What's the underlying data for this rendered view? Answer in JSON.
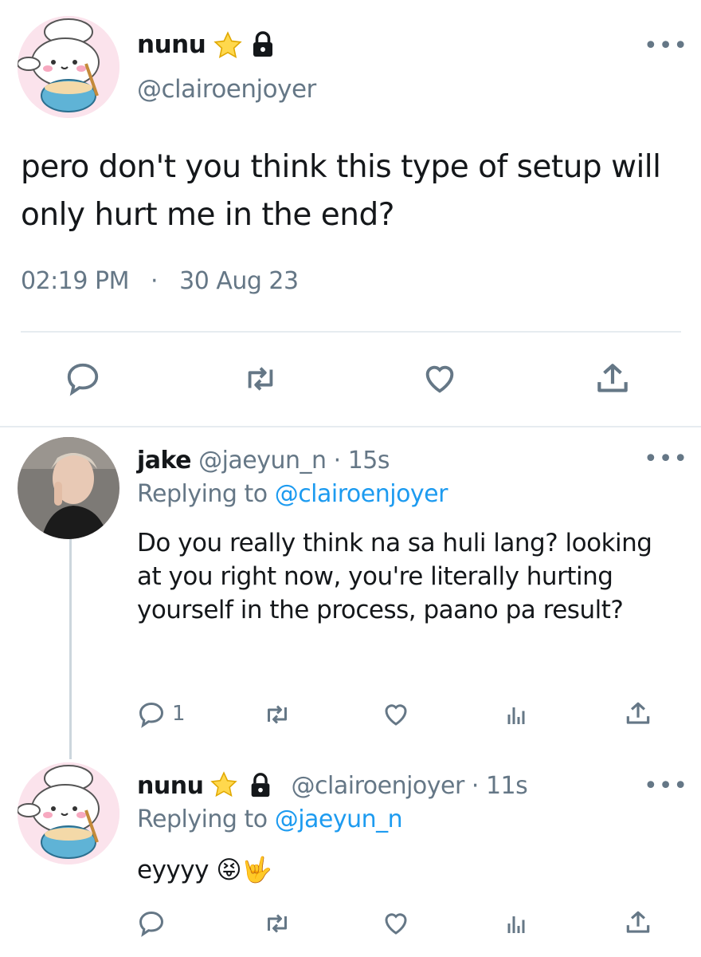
{
  "main_tweet": {
    "display_name": "nunu",
    "handle": "@clairoenjoyer",
    "text": "pero don't you think this type of setup will only hurt me in the end?",
    "time": "02:19 PM",
    "date": "30 Aug 23",
    "separator": "·",
    "more": "•••"
  },
  "replies": [
    {
      "display_name": "jake",
      "handle": "@jaeyun_n",
      "time_sep": "·",
      "age": "15s",
      "replying_label": "Replying to",
      "replying_to": "@clairoenjoyer",
      "text": "Do you really think na sa huli lang? looking at you right now, you're literally hurting yourself in the process, paano pa result?",
      "reply_count": "1",
      "more": "•••"
    },
    {
      "display_name": "nunu",
      "handle": "@clairoenjoyer",
      "time_sep": "·",
      "age": "11s",
      "replying_label": "Replying to",
      "replying_to": "@jaeyun_n",
      "text": "eyyyy",
      "emoji": "😝🤟",
      "more": "•••"
    }
  ],
  "icons": {
    "reply": "reply-icon",
    "retweet": "retweet-icon",
    "like": "heart-icon",
    "share": "share-icon",
    "analytics": "analytics-icon",
    "star": "star-icon",
    "lock": "lock-icon"
  },
  "colors": {
    "link": "#1d9bf0",
    "muted": "#657786",
    "divider": "#e6ecf0"
  }
}
